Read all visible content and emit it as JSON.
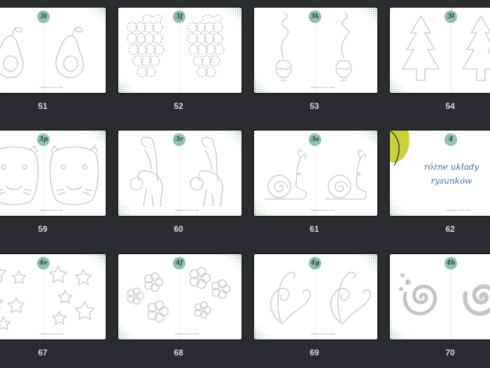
{
  "pages": [
    {
      "number": "51",
      "badge": "3i",
      "art": "avocado",
      "handle": "@dziecko_rob_rob_most"
    },
    {
      "number": "52",
      "badge": "3j",
      "art": "grapes",
      "handle": ""
    },
    {
      "number": "53",
      "badge": "3k",
      "art": "bulb",
      "handle": "@dziecko_rob_rob_most"
    },
    {
      "number": "54",
      "badge": "3l",
      "art": "tree",
      "handle": ""
    },
    {
      "number": "59",
      "badge": "3p",
      "art": "capybara",
      "handle": "@dziecko_rob_rob_most"
    },
    {
      "number": "60",
      "badge": "3r",
      "art": "lemur",
      "handle": "@dziecko_rob_rob_most"
    },
    {
      "number": "61",
      "badge": "3s",
      "art": "snail",
      "handle": "@dziecko_rob_rob_most"
    },
    {
      "number": "62",
      "badge": "4",
      "art": "title",
      "title": [
        "różne układy",
        "rysunków"
      ],
      "handle": "@dziecko_rob_rob_most"
    },
    {
      "number": "67",
      "badge": "4e",
      "art": "stars",
      "handle": "@dziecko_rob_rob_most"
    },
    {
      "number": "68",
      "badge": "4f",
      "art": "flowers",
      "handle": "@dziecko_rob_rob_most"
    },
    {
      "number": "69",
      "badge": "4g",
      "art": "swirls",
      "handle": "@dziecko_rob_rob_most"
    },
    {
      "number": "70",
      "badge": "4h",
      "art": "spirals",
      "handle": ""
    }
  ],
  "colors": {
    "background": "#2b2c2f",
    "badge": "#8fc2a6",
    "badge_text": "#2e3b6a",
    "line": "#cfcfcf",
    "dot": "#7fb89a",
    "accent": "#c9cf3d",
    "title": "#3d6fa1"
  }
}
